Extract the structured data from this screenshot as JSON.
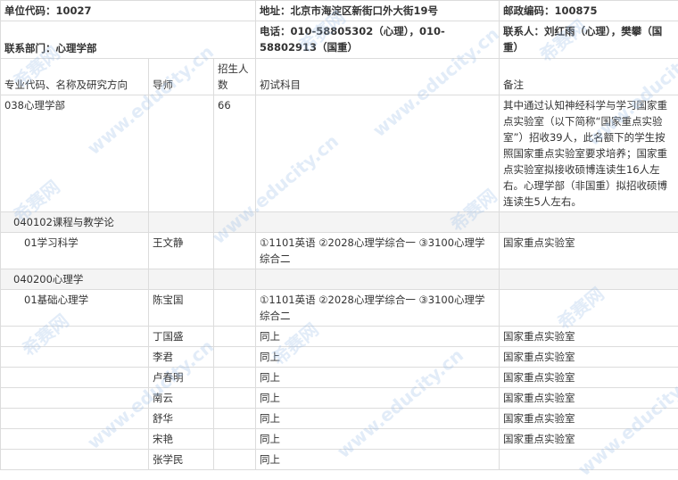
{
  "header": {
    "unit_code": "单位代码：10027",
    "address": "地址：北京市海淀区新街口外大街19号",
    "postal_code": "邮政编码：100875",
    "department": "联系部门：心理学部",
    "phone": "电话：010-58805302（心理），010-58802913（国重）",
    "contact": "联系人：刘红雨（心理），樊攀（国重）"
  },
  "columns": {
    "major": "专业代码、名称及研究方向",
    "advisor": "导师",
    "enrollment": "招生人数",
    "subjects": "初试科目",
    "remarks": "备注"
  },
  "department_row": {
    "name": "038心理学部",
    "enrollment": "66",
    "remarks": "其中通过认知神经科学与学习国家重点实验室（以下简称“国家重点实验室”）招收39人，此名额下的学生按照国家重点实验室要求培养；国家重点实验室拟接收硕博连读生16人左右。心理学部（非国重）拟招收硕博连读生5人左右。"
  },
  "major1": {
    "name": "040102课程与教学论",
    "direction": "01学习科学",
    "advisor": "王文静",
    "subjects": "①1101英语 ②2028心理学综合一 ③3100心理学综合二",
    "remarks": "国家重点实验室"
  },
  "major2": {
    "name": "040200心理学",
    "direction": "01基础心理学",
    "rows": [
      {
        "advisor": "陈宝国",
        "subjects": "①1101英语 ②2028心理学综合一 ③3100心理学综合二",
        "remarks": ""
      },
      {
        "advisor": "丁国盛",
        "subjects": "同上",
        "remarks": "国家重点实验室"
      },
      {
        "advisor": "李君",
        "subjects": "同上",
        "remarks": "国家重点实验室"
      },
      {
        "advisor": "卢春明",
        "subjects": "同上",
        "remarks": "国家重点实验室"
      },
      {
        "advisor": "南云",
        "subjects": "同上",
        "remarks": "国家重点实验室"
      },
      {
        "advisor": "舒华",
        "subjects": "同上",
        "remarks": "国家重点实验室"
      },
      {
        "advisor": "宋艳",
        "subjects": "同上",
        "remarks": "国家重点实验室"
      },
      {
        "advisor": "张学民",
        "subjects": "同上",
        "remarks": ""
      }
    ]
  },
  "watermark": {
    "cn": "希赛网",
    "url": "www.educity.cn",
    "color": "#96b9e6"
  }
}
